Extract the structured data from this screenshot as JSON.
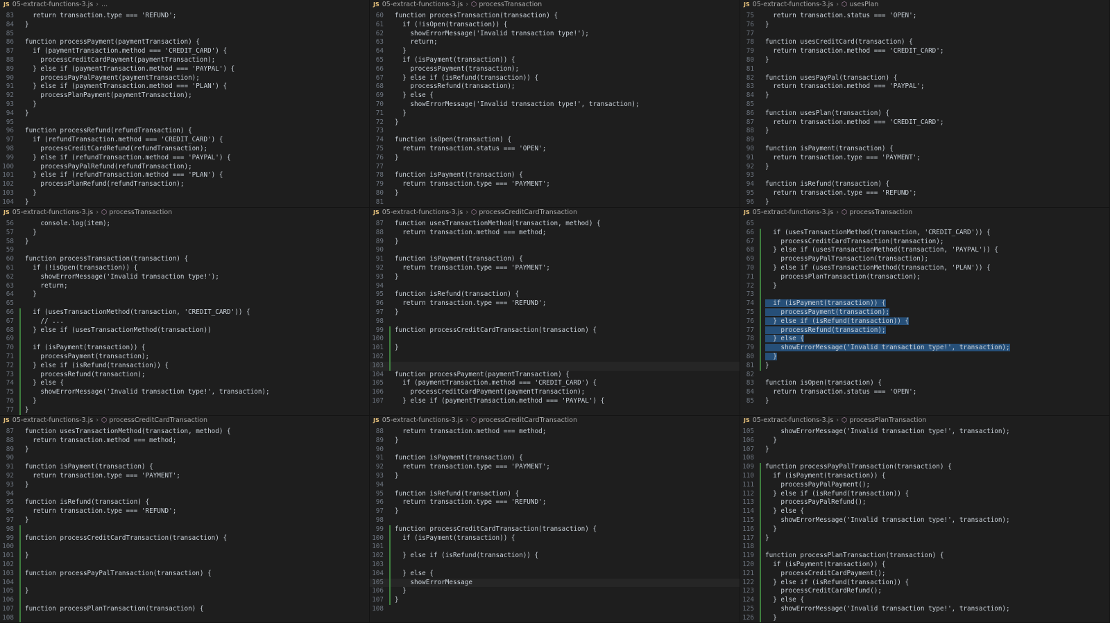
{
  "panes": [
    {
      "file": "05-extract-functions-3.js",
      "symbol": "...",
      "lines": [
        {
          "n": "83",
          "t": "  return transaction.type === 'REFUND';"
        },
        {
          "n": "84",
          "t": "}"
        },
        {
          "n": "85",
          "t": ""
        },
        {
          "n": "86",
          "t": "function processPayment(paymentTransaction) {"
        },
        {
          "n": "87",
          "t": "  if (paymentTransaction.method === 'CREDIT_CARD') {"
        },
        {
          "n": "88",
          "t": "    processCreditCardPayment(paymentTransaction);"
        },
        {
          "n": "89",
          "t": "  } else if (paymentTransaction.method === 'PAYPAL') {"
        },
        {
          "n": "90",
          "t": "    processPayPalPayment(paymentTransaction);"
        },
        {
          "n": "91",
          "t": "  } else if (paymentTransaction.method === 'PLAN') {"
        },
        {
          "n": "92",
          "t": "    processPlanPayment(paymentTransaction);"
        },
        {
          "n": "93",
          "t": "  }"
        },
        {
          "n": "94",
          "t": "}"
        },
        {
          "n": "95",
          "t": ""
        },
        {
          "n": "96",
          "t": "function processRefund(refundTransaction) {"
        },
        {
          "n": "97",
          "t": "  if (refundTransaction.method === 'CREDIT_CARD') {"
        },
        {
          "n": "98",
          "t": "    processCreditCardRefund(refundTransaction);"
        },
        {
          "n": "99",
          "t": "  } else if (refundTransaction.method === 'PAYPAL') {"
        },
        {
          "n": "100",
          "t": "    processPayPalRefund(refundTransaction);"
        },
        {
          "n": "101",
          "t": "  } else if (refundTransaction.method === 'PLAN') {"
        },
        {
          "n": "102",
          "t": "    processPlanRefund(refundTransaction);"
        },
        {
          "n": "103",
          "t": "  }"
        },
        {
          "n": "104",
          "t": "}"
        }
      ]
    },
    {
      "file": "05-extract-functions-3.js",
      "symbol": "processTransaction",
      "lines": [
        {
          "n": "60",
          "t": "function processTransaction(transaction) {"
        },
        {
          "n": "61",
          "t": "  if (!isOpen(transaction)) {"
        },
        {
          "n": "62",
          "t": "    showErrorMessage('Invalid transaction type!');"
        },
        {
          "n": "63",
          "t": "    return;"
        },
        {
          "n": "64",
          "t": "  }"
        },
        {
          "n": "65",
          "t": "  if (isPayment(transaction)) {"
        },
        {
          "n": "66",
          "t": "    processPayment(transaction);"
        },
        {
          "n": "67",
          "t": "  } else if (isRefund(transaction)) {"
        },
        {
          "n": "68",
          "t": "    processRefund(transaction);"
        },
        {
          "n": "69",
          "t": "  } else {"
        },
        {
          "n": "70",
          "t": "    showErrorMessage('Invalid transaction type!', transaction);"
        },
        {
          "n": "71",
          "t": "  }"
        },
        {
          "n": "72",
          "t": "}"
        },
        {
          "n": "73",
          "t": ""
        },
        {
          "n": "74",
          "t": "function isOpen(transaction) {"
        },
        {
          "n": "75",
          "t": "  return transaction.status === 'OPEN';"
        },
        {
          "n": "76",
          "t": "}"
        },
        {
          "n": "77",
          "t": ""
        },
        {
          "n": "78",
          "t": "function isPayment(transaction) {"
        },
        {
          "n": "79",
          "t": "  return transaction.type === 'PAYMENT';"
        },
        {
          "n": "80",
          "t": "}"
        },
        {
          "n": "81",
          "t": ""
        }
      ]
    },
    {
      "file": "05-extract-functions-3.js",
      "symbol": "usesPlan",
      "lines": [
        {
          "n": "75",
          "t": "  return transaction.status === 'OPEN';"
        },
        {
          "n": "76",
          "t": "}"
        },
        {
          "n": "77",
          "t": ""
        },
        {
          "n": "78",
          "t": "function usesCreditCard(transaction) {"
        },
        {
          "n": "79",
          "t": "  return transaction.method === 'CREDIT_CARD';"
        },
        {
          "n": "80",
          "t": "}"
        },
        {
          "n": "81",
          "t": ""
        },
        {
          "n": "82",
          "t": "function usesPayPal(transaction) {"
        },
        {
          "n": "83",
          "t": "  return transaction.method === 'PAYPAL';"
        },
        {
          "n": "84",
          "t": "}"
        },
        {
          "n": "85",
          "t": ""
        },
        {
          "n": "86",
          "t": "function usesPlan(transaction) {"
        },
        {
          "n": "87",
          "t": "  return transaction.method === 'CREDIT_CARD';"
        },
        {
          "n": "88",
          "t": "}"
        },
        {
          "n": "89",
          "t": ""
        },
        {
          "n": "90",
          "t": "function isPayment(transaction) {"
        },
        {
          "n": "91",
          "t": "  return transaction.type === 'PAYMENT';"
        },
        {
          "n": "92",
          "t": "}"
        },
        {
          "n": "93",
          "t": ""
        },
        {
          "n": "94",
          "t": "function isRefund(transaction) {"
        },
        {
          "n": "95",
          "t": "  return transaction.type === 'REFUND';"
        },
        {
          "n": "96",
          "t": "}"
        }
      ]
    },
    {
      "file": "05-extract-functions-3.js",
      "symbol": "processTransaction",
      "lines": [
        {
          "n": "56",
          "t": "    console.log(item);"
        },
        {
          "n": "57",
          "t": "  }"
        },
        {
          "n": "58",
          "t": "}"
        },
        {
          "n": "59",
          "t": ""
        },
        {
          "n": "60",
          "t": "function processTransaction(transaction) {"
        },
        {
          "n": "61",
          "t": "  if (!isOpen(transaction)) {"
        },
        {
          "n": "62",
          "t": "    showErrorMessage('Invalid transaction type!');"
        },
        {
          "n": "63",
          "t": "    return;"
        },
        {
          "n": "64",
          "t": "  }"
        },
        {
          "n": "65",
          "t": ""
        },
        {
          "n": "66",
          "t": "  if (usesTransactionMethod(transaction, 'CREDIT_CARD')) {"
        },
        {
          "n": "67",
          "t": "    // ..."
        },
        {
          "n": "68",
          "t": "  } else if (usesTransactionMethod(transaction))"
        },
        {
          "n": "69",
          "t": ""
        },
        {
          "n": "70",
          "t": "  if (isPayment(transaction)) {"
        },
        {
          "n": "71",
          "t": "    processPayment(transaction);"
        },
        {
          "n": "72",
          "t": "  } else if (isRefund(transaction)) {"
        },
        {
          "n": "73",
          "t": "    processRefund(transaction);"
        },
        {
          "n": "74",
          "t": "  } else {"
        },
        {
          "n": "75",
          "t": "    showErrorMessage('Invalid transaction type!', transaction);"
        },
        {
          "n": "76",
          "t": "  }"
        },
        {
          "n": "77",
          "t": "}"
        }
      ]
    },
    {
      "file": "05-extract-functions-3.js",
      "symbol": "processCreditCardTransaction",
      "lines": [
        {
          "n": "87",
          "t": "function usesTransactionMethod(transaction, method) {"
        },
        {
          "n": "88",
          "t": "  return transaction.method === method;"
        },
        {
          "n": "89",
          "t": "}"
        },
        {
          "n": "90",
          "t": ""
        },
        {
          "n": "91",
          "t": "function isPayment(transaction) {"
        },
        {
          "n": "92",
          "t": "  return transaction.type === 'PAYMENT';"
        },
        {
          "n": "93",
          "t": "}"
        },
        {
          "n": "94",
          "t": ""
        },
        {
          "n": "95",
          "t": "function isRefund(transaction) {"
        },
        {
          "n": "96",
          "t": "  return transaction.type === 'REFUND';"
        },
        {
          "n": "97",
          "t": "}"
        },
        {
          "n": "98",
          "t": ""
        },
        {
          "n": "99",
          "t": "function processCreditCardTransaction(transaction) {"
        },
        {
          "n": "100",
          "t": ""
        },
        {
          "n": "101",
          "t": "}"
        },
        {
          "n": "102",
          "t": ""
        },
        {
          "n": "103",
          "t": ""
        },
        {
          "n": "104",
          "t": "function processPayment(paymentTransaction) {"
        },
        {
          "n": "105",
          "t": "  if (paymentTransaction.method === 'CREDIT_CARD') {"
        },
        {
          "n": "106",
          "t": "    processCreditCardPayment(paymentTransaction);"
        },
        {
          "n": "107",
          "t": "  } else if (paymentTransaction.method === 'PAYPAL') {"
        }
      ]
    },
    {
      "file": "05-extract-functions-3.js",
      "symbol": "processTransaction",
      "lines": [
        {
          "n": "65",
          "t": ""
        },
        {
          "n": "66",
          "t": "  if (usesTransactionMethod(transaction, 'CREDIT_CARD')) {"
        },
        {
          "n": "67",
          "t": "    processCreditCardTransaction(transaction);"
        },
        {
          "n": "68",
          "t": "  } else if (usesTransactionMethod(transaction, 'PAYPAL')) {"
        },
        {
          "n": "69",
          "t": "    processPayPalTransaction(transaction);"
        },
        {
          "n": "70",
          "t": "  } else if (usesTransactionMethod(transaction, 'PLAN')) {"
        },
        {
          "n": "71",
          "t": "    processPlanTransaction(transaction);"
        },
        {
          "n": "72",
          "t": "  }"
        },
        {
          "n": "73",
          "t": ""
        },
        {
          "n": "74",
          "t": "  if (isPayment(transaction)) {"
        },
        {
          "n": "75",
          "t": "    processPayment(transaction);"
        },
        {
          "n": "76",
          "t": "  } else if (isRefund(transaction)) {"
        },
        {
          "n": "77",
          "t": "    processRefund(transaction);"
        },
        {
          "n": "78",
          "t": "  } else {"
        },
        {
          "n": "79",
          "t": "    showErrorMessage('Invalid transaction type!', transaction);"
        },
        {
          "n": "80",
          "t": "  }"
        },
        {
          "n": "81",
          "t": "}"
        },
        {
          "n": "82",
          "t": ""
        },
        {
          "n": "83",
          "t": "function isOpen(transaction) {"
        },
        {
          "n": "84",
          "t": "  return transaction.status === 'OPEN';"
        },
        {
          "n": "85",
          "t": "}"
        }
      ]
    },
    {
      "file": "05-extract-functions-3.js",
      "symbol": "processCreditCardTransaction",
      "lines": [
        {
          "n": "87",
          "t": "function usesTransactionMethod(transaction, method) {"
        },
        {
          "n": "88",
          "t": "  return transaction.method === method;"
        },
        {
          "n": "89",
          "t": "}"
        },
        {
          "n": "90",
          "t": ""
        },
        {
          "n": "91",
          "t": "function isPayment(transaction) {"
        },
        {
          "n": "92",
          "t": "  return transaction.type === 'PAYMENT';"
        },
        {
          "n": "93",
          "t": "}"
        },
        {
          "n": "94",
          "t": ""
        },
        {
          "n": "95",
          "t": "function isRefund(transaction) {"
        },
        {
          "n": "96",
          "t": "  return transaction.type === 'REFUND';"
        },
        {
          "n": "97",
          "t": "}"
        },
        {
          "n": "98",
          "t": ""
        },
        {
          "n": "99",
          "t": "function processCreditCardTransaction(transaction) {"
        },
        {
          "n": "100",
          "t": ""
        },
        {
          "n": "101",
          "t": "}"
        },
        {
          "n": "102",
          "t": ""
        },
        {
          "n": "103",
          "t": "function processPayPalTransaction(transaction) {"
        },
        {
          "n": "104",
          "t": ""
        },
        {
          "n": "105",
          "t": "}"
        },
        {
          "n": "106",
          "t": ""
        },
        {
          "n": "107",
          "t": "function processPlanTransaction(transaction) {"
        },
        {
          "n": "108",
          "t": ""
        }
      ]
    },
    {
      "file": "05-extract-functions-3.js",
      "symbol": "processCreditCardTransaction",
      "lines": [
        {
          "n": "88",
          "t": "  return transaction.method === method;"
        },
        {
          "n": "89",
          "t": "}"
        },
        {
          "n": "90",
          "t": ""
        },
        {
          "n": "91",
          "t": "function isPayment(transaction) {"
        },
        {
          "n": "92",
          "t": "  return transaction.type === 'PAYMENT';"
        },
        {
          "n": "93",
          "t": "}"
        },
        {
          "n": "94",
          "t": ""
        },
        {
          "n": "95",
          "t": "function isRefund(transaction) {"
        },
        {
          "n": "96",
          "t": "  return transaction.type === 'REFUND';"
        },
        {
          "n": "97",
          "t": "}"
        },
        {
          "n": "98",
          "t": ""
        },
        {
          "n": "99",
          "t": "function processCreditCardTransaction(transaction) {"
        },
        {
          "n": "100",
          "t": "  if (isPayment(transaction)) {"
        },
        {
          "n": "101",
          "t": ""
        },
        {
          "n": "102",
          "t": "  } else if (isRefund(transaction)) {"
        },
        {
          "n": "103",
          "t": ""
        },
        {
          "n": "104",
          "t": "  } else {"
        },
        {
          "n": "105",
          "t": "    showErrorMessage"
        },
        {
          "n": "106",
          "t": "  }"
        },
        {
          "n": "107",
          "t": "}"
        },
        {
          "n": "108",
          "t": ""
        }
      ]
    },
    {
      "file": "05-extract-functions-3.js",
      "symbol": "processPlanTransaction",
      "lines": [
        {
          "n": "105",
          "t": "    showErrorMessage('Invalid transaction type!', transaction);"
        },
        {
          "n": "106",
          "t": "  }"
        },
        {
          "n": "107",
          "t": "}"
        },
        {
          "n": "108",
          "t": ""
        },
        {
          "n": "109",
          "t": "function processPayPalTransaction(transaction) {"
        },
        {
          "n": "110",
          "t": "  if (isPayment(transaction)) {"
        },
        {
          "n": "111",
          "t": "    processPayPalPayment();"
        },
        {
          "n": "112",
          "t": "  } else if (isRefund(transaction)) {"
        },
        {
          "n": "113",
          "t": "    processPayPalRefund();"
        },
        {
          "n": "114",
          "t": "  } else {"
        },
        {
          "n": "115",
          "t": "    showErrorMessage('Invalid transaction type!', transaction);"
        },
        {
          "n": "116",
          "t": "  }"
        },
        {
          "n": "117",
          "t": "}"
        },
        {
          "n": "118",
          "t": ""
        },
        {
          "n": "119",
          "t": "function processPlanTransaction(transaction) {"
        },
        {
          "n": "120",
          "t": "  if (isPayment(transaction)) {"
        },
        {
          "n": "121",
          "t": "    processCreditCardPayment();"
        },
        {
          "n": "122",
          "t": "  } else if (isRefund(transaction)) {"
        },
        {
          "n": "123",
          "t": "    processCreditCardRefund();"
        },
        {
          "n": "124",
          "t": "  } else {"
        },
        {
          "n": "125",
          "t": "    showErrorMessage('Invalid transaction type!', transaction);"
        },
        {
          "n": "126",
          "t": "  }"
        }
      ]
    }
  ]
}
